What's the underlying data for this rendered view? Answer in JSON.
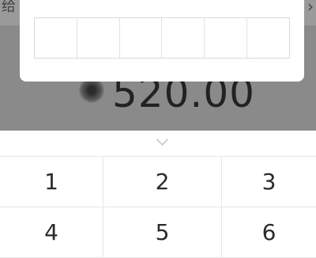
{
  "header": {
    "left_text": "给",
    "right_chevron": "chevron-right-icon"
  },
  "amount": {
    "currency_icon": "currency-symbol-icon",
    "value": "520.00"
  },
  "dialog": {
    "pin_length": 6
  },
  "keypad": {
    "collapse_icon": "chevron-down-icon",
    "keys": [
      "1",
      "2",
      "3",
      "4",
      "5",
      "6"
    ]
  }
}
